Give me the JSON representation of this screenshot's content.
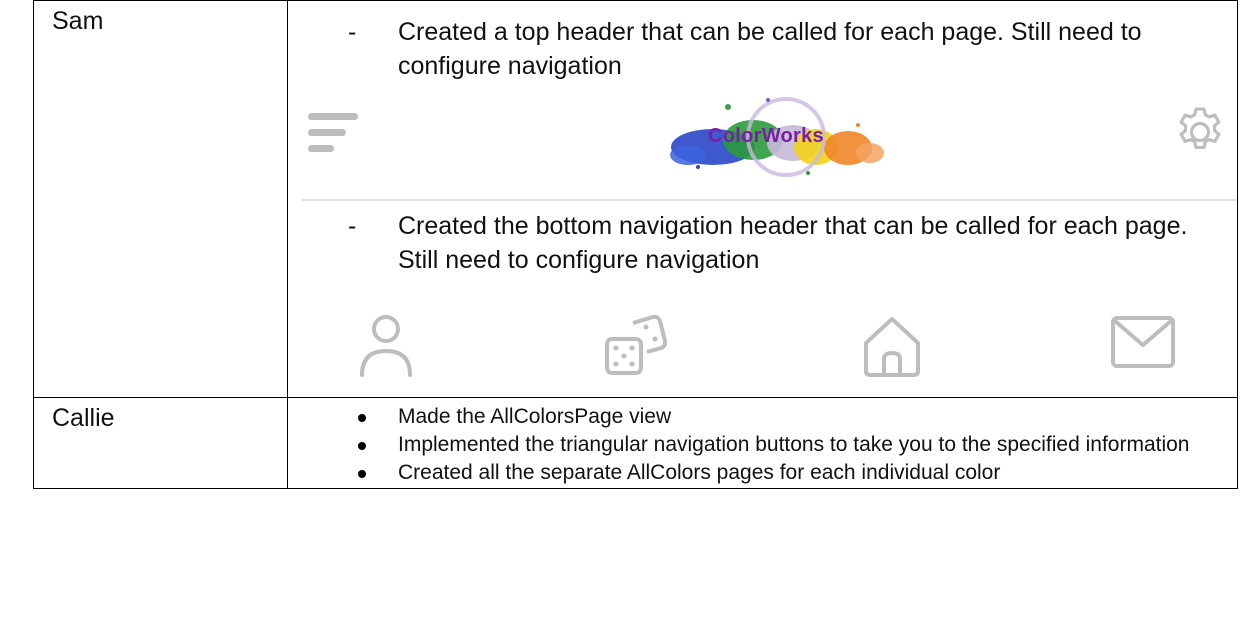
{
  "rows": [
    {
      "name": "Sam",
      "items": [
        "Created a top header that can be called for each page. Still need to configure navigation",
        "Created the bottom navigation header that can be called for each page. Still need to configure navigation"
      ],
      "dash_symbol": "-",
      "header_preview": {
        "logo_text": "ColorWorks",
        "icons": [
          "menu-icon",
          "gear-icon"
        ]
      },
      "nav_preview": {
        "icons": [
          "person-icon",
          "dice-icon",
          "home-icon",
          "mail-icon"
        ]
      }
    },
    {
      "name": "Callie",
      "items": [
        "Made the AllColorsPage view",
        "Implemented the triangular navigation buttons to take you to the specified information",
        "Created all the separate AllColors pages for each individual color"
      ]
    }
  ],
  "colors": {
    "icon_gray": "#bdbdbd",
    "logo_text": "#7a1ea8",
    "border": "#000000"
  }
}
